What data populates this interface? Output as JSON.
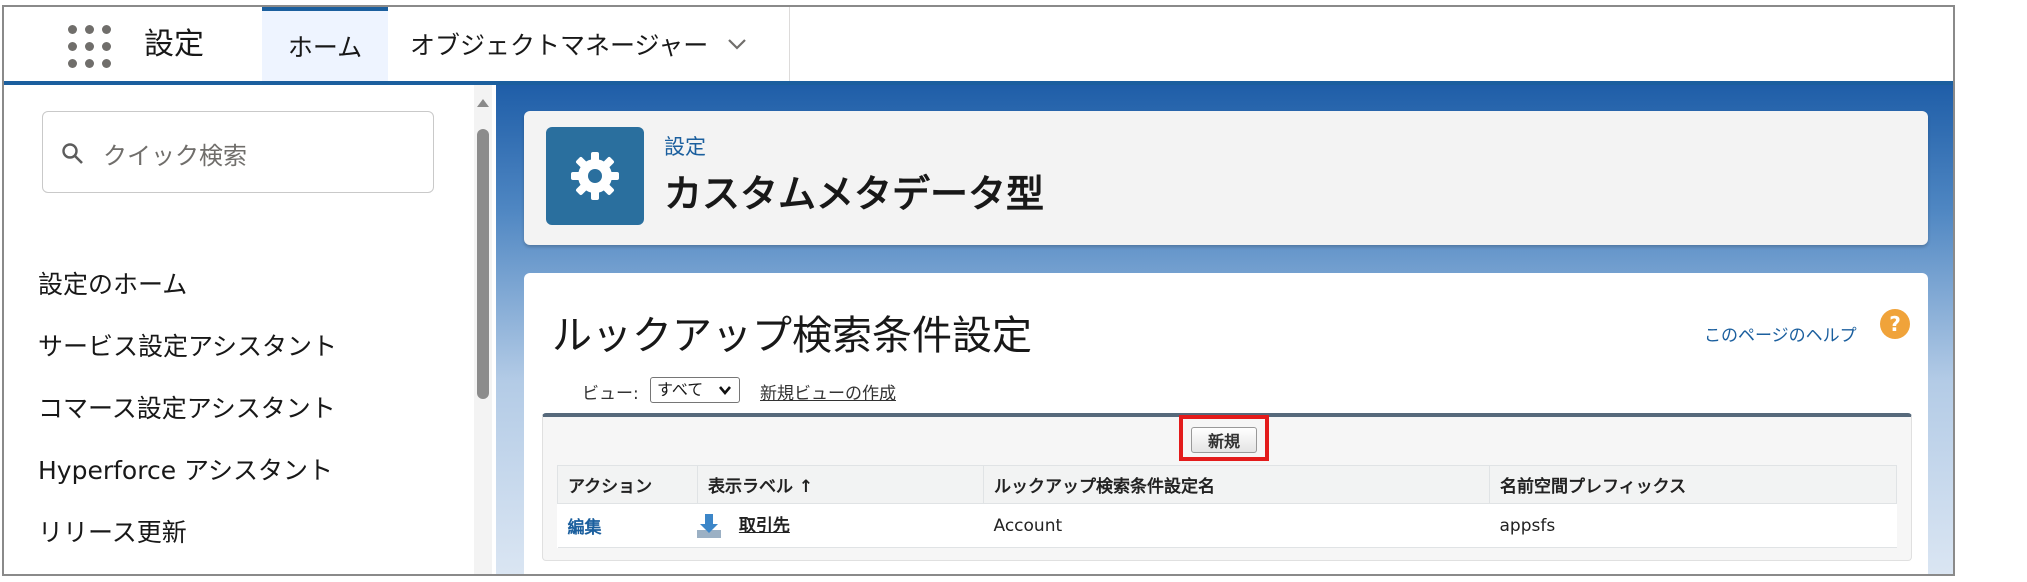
{
  "topnav": {
    "app_name": "設定",
    "tabs": [
      {
        "label": "ホーム",
        "active": true
      },
      {
        "label": "オブジェクトマネージャー",
        "dropdown": true
      }
    ]
  },
  "sidebar": {
    "search_placeholder": "クイック検索",
    "items": [
      {
        "label": "設定のホーム"
      },
      {
        "label": "サービス設定アシスタント"
      },
      {
        "label": "コマース設定アシスタント"
      },
      {
        "label": "Hyperforce アシスタント"
      },
      {
        "label": "リリース更新"
      }
    ]
  },
  "header": {
    "breadcrumb": "設定",
    "title": "カスタムメタデータ型",
    "icon": "gear-icon"
  },
  "content": {
    "page_title": "ルックアップ検索条件設定",
    "help_link": "このページのヘルプ",
    "view_label": "ビュー:",
    "view_selected": "すべて",
    "new_view_link": "新規ビューの作成",
    "new_button": "新規",
    "columns": [
      "アクション",
      "表示ラベル ↑",
      "ルックアップ検索条件設定名",
      "名前空間プレフィックス"
    ],
    "rows": [
      {
        "action": "編集",
        "label": "取引先",
        "name": "Account",
        "prefix": "appsfs"
      }
    ]
  },
  "colors": {
    "brand": "#1b5f9e",
    "highlight": "#e31b1b",
    "header_icon_bg": "#2a6f9e"
  }
}
